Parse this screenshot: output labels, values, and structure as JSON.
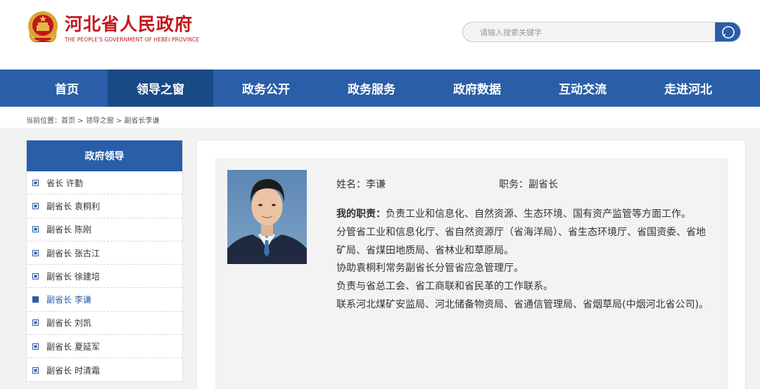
{
  "header": {
    "title": "河北省人民政府",
    "subtitle": "THE PEOPLE'S GOVERNMENT OF HEBEI PROVINCE",
    "logo_icon": "national-emblem-icon",
    "search_placeholder": "请输入搜索关键字",
    "search_icon": "search-icon"
  },
  "colors": {
    "brand_red": "#c4161c",
    "nav_blue": "#2a5ea8",
    "nav_active": "#1a4a86"
  },
  "nav": {
    "items": [
      {
        "label": "首页"
      },
      {
        "label": "领导之窗",
        "active": true
      },
      {
        "label": "政务公开"
      },
      {
        "label": "政务服务"
      },
      {
        "label": "政府数据"
      },
      {
        "label": "互动交流"
      },
      {
        "label": "走进河北"
      }
    ]
  },
  "breadcrumb": {
    "text": "当前位置：首页 > 领导之窗 > 副省长李谦"
  },
  "sidebar": {
    "title": "政府领导",
    "items": [
      {
        "label": "省长 许勤"
      },
      {
        "label": "副省长 袁桐利"
      },
      {
        "label": "副省长 陈刚"
      },
      {
        "label": "副省长 张古江"
      },
      {
        "label": "副省长 徐建培"
      },
      {
        "label": "副省长 李谦",
        "active": true
      },
      {
        "label": "副省长 刘凯"
      },
      {
        "label": "副省长 夏延军"
      },
      {
        "label": "副省长 时清霜"
      }
    ]
  },
  "profile": {
    "name_label": "姓名：",
    "name": "李谦",
    "position_label": "职务：",
    "position": "副省长",
    "duties_label": "我的职责：",
    "duties_first": "负责工业和信息化、自然资源、生态环境、国有资产监管等方面工作。",
    "lines": [
      "分管省工业和信息化厅、省自然资源厅（省海洋局）、省生态环境厅、省国资委、省地矿局、省煤田地质局、省林业和草原局。",
      "协助袁桐利常务副省长分管省应急管理厅。",
      "负责与省总工会、省工商联和省民革的工作联系。",
      "联系河北煤矿安监局、河北储备物资局、省通信管理局、省烟草局(中烟河北省公司)。"
    ]
  }
}
